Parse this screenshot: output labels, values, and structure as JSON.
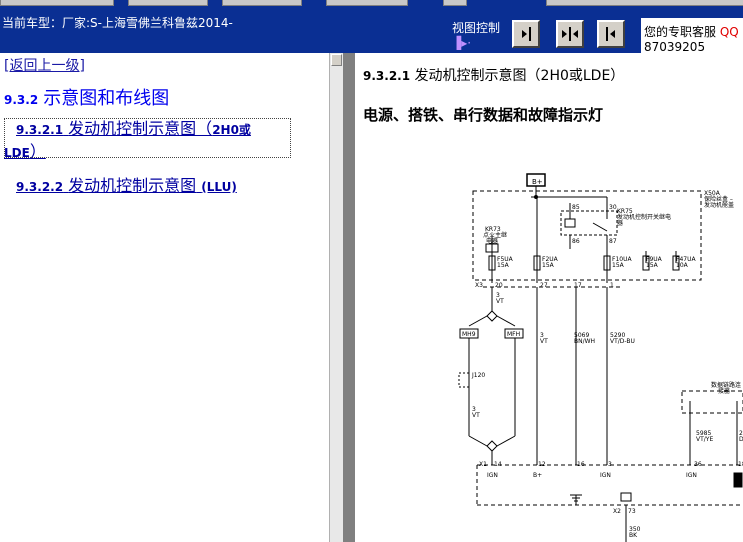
{
  "header": {
    "vehicle_label": "当前车型：厂家:S-上海雪佛兰科鲁兹2014-",
    "view_control_label": "视图控制",
    "view_buttons": [
      "collapse-left",
      "split-center",
      "collapse-right"
    ],
    "service_label": "您的专职客服",
    "service_qq": "QQ",
    "service_phone": "87039205"
  },
  "nav": {
    "back_link": "[返回上一级]",
    "section_num": "9.3.2",
    "section_title": "示意图和布线图",
    "items": [
      {
        "num": "9.3.2.1",
        "title": "发动机控制示意图（",
        "code": "2H0或",
        "code2": "LDE",
        "tail": "）"
      },
      {
        "num": "9.3.2.2",
        "title": "发动机控制示意图",
        "code": "(LLU)"
      }
    ]
  },
  "content": {
    "section_num": "9.3.2.1",
    "section_title": "发动机控制示意图（2H0或LDE）",
    "diagram_title": "电源、搭铁、串行数据和故障指示灯",
    "diagram": {
      "battery": "B+",
      "block_label": [
        "X50A",
        "保险丝盒 –",
        "发动机舱盖"
      ],
      "relay_label": [
        "KR75",
        "发动机控制开关继电",
        "器"
      ],
      "ignition_relay_label": [
        "KR73",
        "点火主继",
        "电器"
      ],
      "relay_pins": {
        "p85": "85",
        "p30": "30",
        "p86": "86",
        "p87": "87"
      },
      "fuses": [
        {
          "name": "F5UA",
          "rating": "15A"
        },
        {
          "name": "F2UA",
          "rating": "15A"
        },
        {
          "name": "F10UA",
          "rating": "15A"
        },
        {
          "name": "F9UA",
          "rating": "15A"
        },
        {
          "name": "F47UA",
          "rating": "10A"
        }
      ],
      "x3_label": "X3",
      "x3_pins": [
        "20",
        "27",
        "17",
        "1"
      ],
      "wires": [
        {
          "gauge": "3",
          "color": "VT"
        },
        {
          "gauge": "3",
          "color": "VT"
        },
        {
          "gauge": "5069",
          "color": "BN/WH"
        },
        {
          "gauge": "5290",
          "color": "VT/D-BU"
        },
        {
          "gauge": "3",
          "color": "VT"
        },
        {
          "gauge": "5985",
          "color": "VT/YE"
        },
        {
          "gauge": "2",
          "color": "D"
        },
        {
          "gauge": "350",
          "color": "BK"
        }
      ],
      "splices": [
        "MH9",
        "MFH"
      ],
      "jumper": "J120",
      "dlc_label": [
        "数据链路连",
        "接器"
      ],
      "x1_label": "X1",
      "x1_pins": [
        "14",
        "12",
        "16",
        "3",
        "36",
        "18"
      ],
      "x1_funcs": [
        "IGN",
        "B+",
        "IGN",
        "IGN"
      ],
      "x2_label": "X2",
      "x2_pin": "73"
    }
  }
}
